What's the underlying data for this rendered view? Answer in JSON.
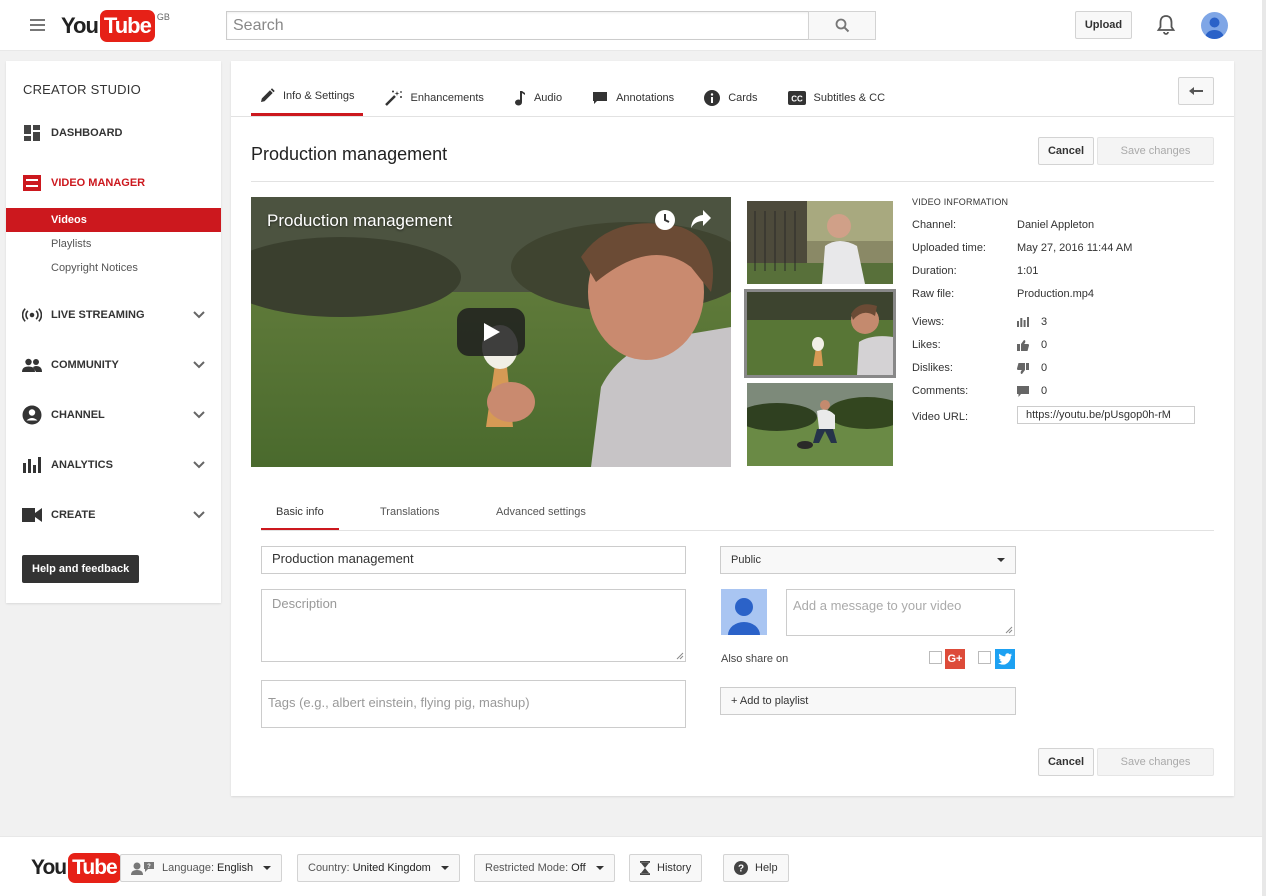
{
  "masthead": {
    "logo_you": "You",
    "logo_tube": "Tube",
    "logo_region": "GB",
    "search_placeholder": "Search",
    "upload_label": "Upload"
  },
  "sidebar": {
    "title": "CREATOR STUDIO",
    "items": [
      {
        "label": "DASHBOARD",
        "icon": "dashboard-icon"
      },
      {
        "label": "VIDEO MANAGER",
        "icon": "video-manager-icon"
      },
      {
        "label": "LIVE STREAMING",
        "icon": "live-streaming-icon"
      },
      {
        "label": "COMMUNITY",
        "icon": "community-icon"
      },
      {
        "label": "CHANNEL",
        "icon": "channel-icon"
      },
      {
        "label": "ANALYTICS",
        "icon": "analytics-icon"
      },
      {
        "label": "CREATE",
        "icon": "create-icon"
      }
    ],
    "sub_items": [
      "Videos",
      "Playlists",
      "Copyright Notices"
    ],
    "help_label": "Help and feedback"
  },
  "tabs": [
    {
      "label": "Info & Settings",
      "icon": "pencil-icon"
    },
    {
      "label": "Enhancements",
      "icon": "magic-wand-icon"
    },
    {
      "label": "Audio",
      "icon": "music-note-icon"
    },
    {
      "label": "Annotations",
      "icon": "speech-bubble-icon"
    },
    {
      "label": "Cards",
      "icon": "info-icon"
    },
    {
      "label": "Subtitles & CC",
      "icon": "cc-icon"
    }
  ],
  "video": {
    "title": "Production management",
    "player_title": "Production management"
  },
  "actions": {
    "cancel": "Cancel",
    "save": "Save changes"
  },
  "video_info": {
    "heading": "VIDEO INFORMATION",
    "rows": [
      {
        "label": "Channel:",
        "value": "Daniel Appleton"
      },
      {
        "label": "Uploaded time:",
        "value": "May 27, 2016 11:44 AM"
      },
      {
        "label": "Duration:",
        "value": "1:01"
      },
      {
        "label": "Raw file:",
        "value": "Production.mp4"
      },
      {
        "label": "Views:",
        "value": "3"
      },
      {
        "label": "Likes:",
        "value": "0"
      },
      {
        "label": "Dislikes:",
        "value": "0"
      },
      {
        "label": "Comments:",
        "value": "0"
      },
      {
        "label": "Video URL:",
        "value": "https://youtu.be/pUsgop0h-rM"
      }
    ]
  },
  "sub_tabs": [
    "Basic info",
    "Translations",
    "Advanced settings"
  ],
  "form": {
    "title_value": "Production management",
    "description_placeholder": "Description",
    "tags_placeholder": "Tags (e.g., albert einstein, flying pig, mashup)",
    "privacy_value": "Public",
    "message_placeholder": "Add a message to your video",
    "also_share": "Also share on",
    "gplus_label": "G+",
    "add_playlist": "+ Add to playlist"
  },
  "footer": {
    "logo_you": "You",
    "logo_tube": "Tube",
    "language_key": "Language:",
    "language_value": "English",
    "country_key": "Country:",
    "country_value": "United Kingdom",
    "restricted_key": "Restricted Mode:",
    "restricted_value": "Off",
    "history_label": "History",
    "help_label": "Help"
  },
  "colors": {
    "accent": "#cc181e",
    "brand_red": "#e62117",
    "gplus": "#dd4b39",
    "twitter": "#1da1f2"
  }
}
